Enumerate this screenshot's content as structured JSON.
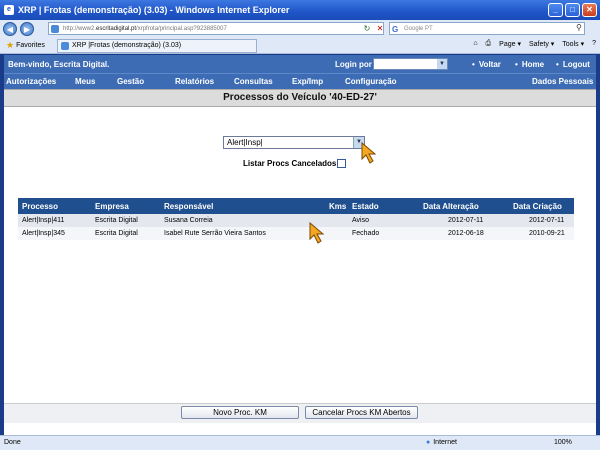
{
  "window": {
    "title": "XRP | Frotas (demonstração) (3.03) - Windows Internet Explorer",
    "min": "_",
    "max": "□",
    "close": "✕"
  },
  "browser": {
    "url_prefix": "http://www2.",
    "url_host": "escritadigital.pt",
    "url_path": "/xrpfrota/principal.asp?923885007",
    "search_placeholder": "Google PT",
    "favorites_label": "Favorites",
    "tab_title": "XRP |Frotas (demonstração) (3.03)",
    "tools": [
      "Page ▾",
      "Safety ▾",
      "Tools ▾",
      "?"
    ]
  },
  "header": {
    "welcome": "Bem-vindo, Escrita Digital.",
    "login_label": "Login por",
    "links": [
      "Voltar",
      "Home",
      "Logout"
    ]
  },
  "menu": {
    "items": [
      "Autorizações",
      "Meus",
      "Gestão",
      "Relatórios",
      "Consultas",
      "Exp/Imp",
      "Configuração"
    ],
    "right": "Dados Pessoais"
  },
  "page_title": "Processos do Veículo '40-ED-27'",
  "filter": {
    "selected": "Alert|Insp|",
    "cancel_label": "Listar Procs Cancelados"
  },
  "table": {
    "columns": [
      "Processo",
      "Empresa",
      "Responsável",
      "Kms",
      "Estado",
      "Data Alteração",
      "Data Criação"
    ],
    "rows": [
      [
        "Alert|Insp|411",
        "Escrita Digital",
        "Susana Correia",
        "",
        "Aviso",
        "2012-07-11",
        "2012-07-11"
      ],
      [
        "Alert|Insp|345",
        "Escrita Digital",
        "Isabel Rute Serrão Vieira Santos",
        "",
        "Fechado",
        "2012-06-18",
        "2010-09-21"
      ]
    ]
  },
  "buttons": {
    "new": "Novo Proc. KM",
    "cancel": "Cancelar Procs KM Abertos"
  },
  "status": {
    "text": "Done",
    "zone": "Internet",
    "zoom": "100%"
  }
}
